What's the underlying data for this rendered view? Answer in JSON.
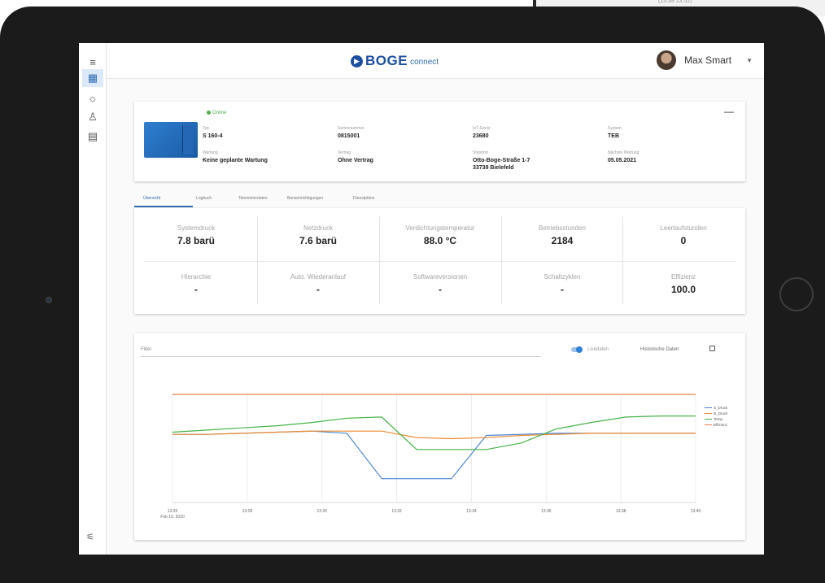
{
  "header": {
    "logo_mark": "▶",
    "logo_text": "BOGE",
    "logo_sub": "connect",
    "user_name": "Max Smart",
    "caret": "▼"
  },
  "sidebar": {
    "items": [
      {
        "icon": "menu-icon",
        "glyph": "≡"
      },
      {
        "icon": "dashboard-icon",
        "glyph": "▦"
      },
      {
        "icon": "network-icon",
        "glyph": "☼"
      },
      {
        "icon": "user-tree-icon",
        "glyph": "♙"
      },
      {
        "icon": "compressor-settings-icon",
        "glyph": "▤"
      }
    ],
    "bottom": {
      "icon": "settings-sliders-icon",
      "glyph": "⚟"
    }
  },
  "machine": {
    "status": "Online",
    "collapse": "—",
    "fields": [
      {
        "label": "Typ",
        "value": "S 160-4"
      },
      {
        "label": "Seriennummer",
        "value": "0815001"
      },
      {
        "label": "IoT-Gerät",
        "value": "23680"
      },
      {
        "label": "System",
        "value": "TEB"
      },
      {
        "label": "Wartung",
        "value": "Keine geplante Wartung"
      },
      {
        "label": "Vertrag",
        "value": "Ohne Vertrag"
      },
      {
        "label": "Standort",
        "value": "Otto-Boge-Straße 1-7",
        "value2": "33739 Bielefeld"
      },
      {
        "label": "Nächste Wartung",
        "value": "05.05.2021"
      }
    ]
  },
  "tabs": [
    "Übersicht",
    "Logbuch",
    "Telemetriedaten",
    "Benachrichtigungen",
    "Dienstpläne"
  ],
  "stats": [
    {
      "label": "Systemdruck",
      "value": "7.8 barü"
    },
    {
      "label": "Netzdruck",
      "value": "7.6 barü"
    },
    {
      "label": "Verdichtungstemperatur",
      "value": "88.0 °C"
    },
    {
      "label": "Betriebsstunden",
      "value": "2184"
    },
    {
      "label": "Leerlaufstunden",
      "value": "0"
    },
    {
      "label": "Hierarchie",
      "value": "-"
    },
    {
      "label": "Auto. Wiederanlauf",
      "value": "-"
    },
    {
      "label": "Softwareversionen",
      "value": "-"
    },
    {
      "label": "Schaltzyklen",
      "value": "-"
    },
    {
      "label": "Effizienz",
      "value": "100.0"
    }
  ],
  "chart_controls": {
    "filter_placeholder": "Filter",
    "live_label": "Livedaten",
    "historic_label": "Historische Daten",
    "live_on": true
  },
  "chart_data": {
    "type": "line",
    "x": [
      "13:26",
      "13:28",
      "13:30",
      "13:32",
      "13:34",
      "13:36",
      "13:38",
      "13:40"
    ],
    "x_sublabel": "Feb 10, 2020",
    "series": [
      {
        "name": "S_Druck",
        "color": "#4a86d8",
        "values": [
          0.63,
          0.63,
          0.64,
          0.65,
          0.66,
          0.64,
          0.22,
          0.22,
          0.22,
          0.62,
          0.63,
          0.64,
          0.64,
          0.64,
          0.64,
          0.64
        ]
      },
      {
        "name": "N_Druck",
        "color": "#ef8a2e",
        "values": [
          0.63,
          0.63,
          0.64,
          0.65,
          0.66,
          0.66,
          0.66,
          0.6,
          0.59,
          0.6,
          0.62,
          0.63,
          0.64,
          0.64,
          0.64,
          0.64
        ]
      },
      {
        "name": "Temp",
        "color": "#45b449",
        "values": [
          0.65,
          0.67,
          0.69,
          0.71,
          0.74,
          0.78,
          0.79,
          0.49,
          0.49,
          0.49,
          0.55,
          0.68,
          0.74,
          0.79,
          0.8,
          0.8
        ]
      },
      {
        "name": "Effizienz",
        "color": "#ee7d52",
        "values": [
          1,
          1,
          1,
          1,
          1,
          1,
          1,
          1,
          1,
          1,
          1,
          1,
          1,
          1,
          1,
          1
        ]
      }
    ],
    "grid": true,
    "legend_position": "right"
  }
}
